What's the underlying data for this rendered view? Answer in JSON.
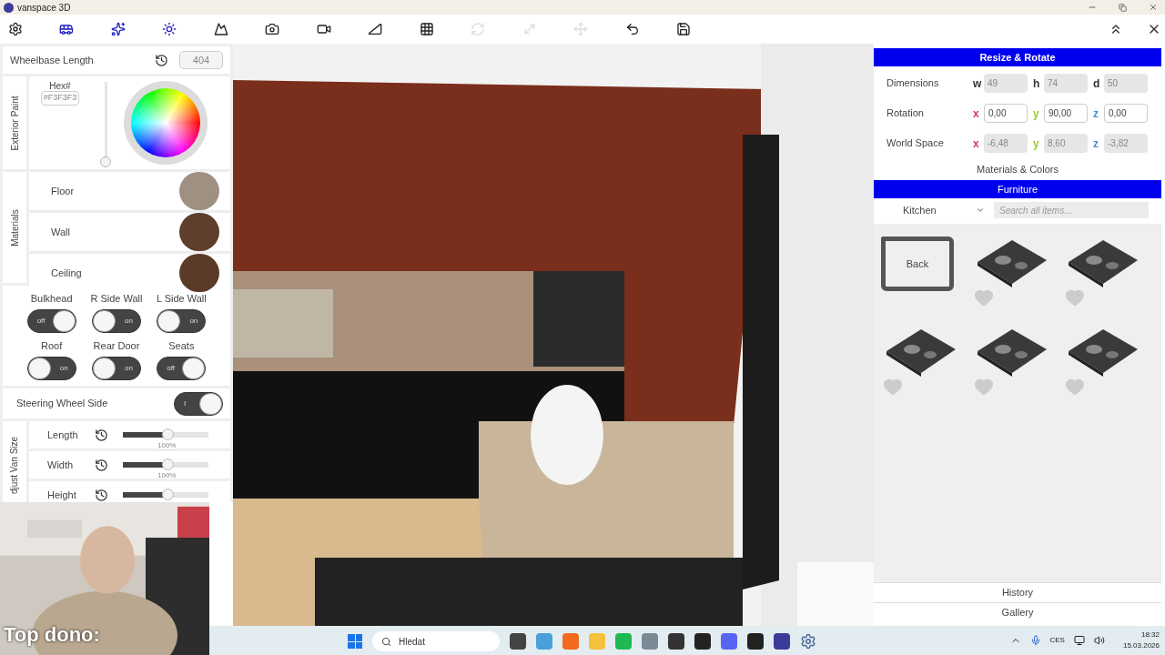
{
  "window": {
    "title": "vanspace 3D"
  },
  "toolbar": [
    {
      "kind": "settings",
      "selected": false,
      "disabled": false
    },
    {
      "kind": "van",
      "selected": true,
      "disabled": false
    },
    {
      "kind": "sparkles",
      "selected": true,
      "disabled": false
    },
    {
      "kind": "sun",
      "selected": true,
      "disabled": false
    },
    {
      "kind": "mountain",
      "selected": false,
      "disabled": false
    },
    {
      "kind": "camera",
      "selected": false,
      "disabled": false
    },
    {
      "kind": "video",
      "selected": false,
      "disabled": false
    },
    {
      "kind": "ruler",
      "selected": false,
      "disabled": false
    },
    {
      "kind": "grid",
      "selected": false,
      "disabled": false
    },
    {
      "kind": "rotate",
      "disabled": true
    },
    {
      "kind": "resize",
      "disabled": true
    },
    {
      "kind": "move",
      "disabled": true
    },
    {
      "kind": "undo",
      "selected": false,
      "disabled": false
    },
    {
      "kind": "save",
      "selected": false,
      "disabled": false
    }
  ],
  "left_panel": {
    "wheelbase": {
      "label": "Wheelbase Length",
      "value": "404"
    },
    "exterior_paint": {
      "title": "Exterior Paint",
      "hex_label": "Hex#",
      "hex_value": "#F3F3F3",
      "level": 0
    },
    "materials": {
      "title": "Materials",
      "items": [
        {
          "label": "Floor",
          "color": "#9e9181"
        },
        {
          "label": "Wall",
          "color": "#5e3f2c"
        },
        {
          "label": "Ceiling",
          "color": "#5b3a28"
        }
      ]
    },
    "toggles": [
      {
        "label": "Bulkhead",
        "knob_right": true,
        "text": "off"
      },
      {
        "label": "R Side Wall",
        "knob_right": false,
        "text": "on"
      },
      {
        "label": "L Side Wall",
        "knob_right": false,
        "text": "on"
      },
      {
        "label": "Roof",
        "knob_right": false,
        "text": "on"
      },
      {
        "label": "Rear Door",
        "knob_right": false,
        "text": "on"
      },
      {
        "label": "Seats",
        "knob_right": true,
        "text": "off"
      }
    ],
    "steering": {
      "label": "Steering Wheel Side",
      "knob_right": true,
      "text": "I"
    },
    "van_size": {
      "title": "djust Van Size",
      "sliders": [
        {
          "label": "Length",
          "level": 0.52,
          "reading": "100%"
        },
        {
          "label": "Width",
          "level": 0.52,
          "reading": "100%"
        },
        {
          "label": "Height",
          "level": 0.52
        }
      ]
    }
  },
  "right_panel": {
    "resize_title": "Resize & Rotate",
    "rows": [
      {
        "label": "Dimensions",
        "editable": false,
        "fields": [
          {
            "axis": "w",
            "value": "49"
          },
          {
            "axis": "h",
            "value": "74"
          },
          {
            "axis": "d",
            "value": "50"
          }
        ]
      },
      {
        "label": "Rotation",
        "editable": true,
        "fields": [
          {
            "axis": "x",
            "value": "0,00"
          },
          {
            "axis": "y",
            "value": "90,00"
          },
          {
            "axis": "z",
            "value": "0,00"
          }
        ]
      },
      {
        "label": "World Space",
        "editable": false,
        "fields": [
          {
            "axis": "x",
            "value": "-6,48"
          },
          {
            "axis": "y",
            "value": "8,60"
          },
          {
            "axis": "z",
            "value": "-3,82"
          }
        ]
      }
    ],
    "materials_link": "Materials & Colors",
    "furniture_title": "Furniture",
    "category": "Kitchen",
    "search_placeholder": "Search all items...",
    "items": [
      {
        "kind": "folder",
        "label": "Back"
      },
      {
        "kind": "item",
        "favorite": false
      },
      {
        "kind": "item",
        "favorite": false
      },
      {
        "kind": "item",
        "favorite": false
      },
      {
        "kind": "item",
        "favorite": false
      },
      {
        "kind": "item",
        "favorite": false
      }
    ],
    "footer": [
      "History",
      "Gallery"
    ]
  },
  "webcam": {
    "overlay_text": "Top dono:"
  },
  "taskbar": {
    "search": "Hledat",
    "language": "CES",
    "time": "18:32",
    "date": "15.03.2026"
  }
}
